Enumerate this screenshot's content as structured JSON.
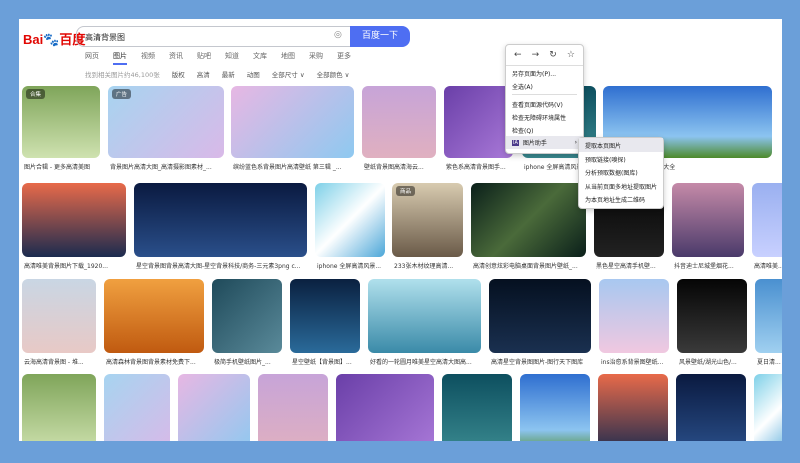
{
  "logo": "Bai百度",
  "search": {
    "value": "高清背景图",
    "button": "百度一下"
  },
  "tabs": [
    "网页",
    "图片",
    "视频",
    "资讯",
    "贴吧",
    "知道",
    "文库",
    "地图",
    "采购",
    "更多"
  ],
  "active_tab": 1,
  "filters": {
    "count": "找到相关图片约46,100张",
    "items": [
      "版权",
      "高清",
      "最新",
      "动图",
      "全部尺寸 ∨",
      "全部颜色 ∨"
    ]
  },
  "badges": {
    "collection": "合集",
    "ad": "广告",
    "store": "商品"
  },
  "rows": [
    [
      "图片合辑 - 更多高清美图",
      "背景图片高清大图_高清摄影图素材_...",
      "缤纷蓝色系背景图片高清壁纸 第三辑 _...",
      "壁纸背景图高清海云...",
      "紫色系高清背景图手...",
      "iphone 全屏高清风景...",
      "...片.jpg格式]_小制作大全"
    ],
    [
      "高清唯美背景图片下载_1920...",
      "星空背景图背景高清大图-星空背景科技/商务-三元素3png c...",
      "iphone 全屏高清风景...",
      "233张木材纹理高清...",
      "高清创意炫彩电脑桌面背景图片壁纸_...",
      "黑色星空高清手机壁...",
      "抖音迪士尼城堡烟花...",
      "高清唯美..."
    ],
    [
      "云海高清背景图 - 堆...",
      "高清森林背景图背景素材免费下...",
      "极简手机壁纸图片_...",
      "星空壁纸【背景图】...",
      "好看的一轮圆月唯美星空高清大图高...",
      "高清星空背景图图片-图行天下图库",
      "ins治愈系背景图壁纸...",
      "风景壁纸/湖光山色/...",
      "夏日清..."
    ],
    []
  ],
  "context_menu": {
    "items": [
      "另存页面为(P)...",
      "全选(A)",
      "查看页面源代码(V)",
      "检查无障碍环境属性",
      "检查(Q)",
      "图片助手"
    ]
  },
  "submenu": {
    "items": [
      "提取本页图片",
      "预取链接(嗅探)",
      "分析预取数据(图库)",
      "从当前页面多地址提取图片",
      "为本页地址生成二维码"
    ]
  }
}
